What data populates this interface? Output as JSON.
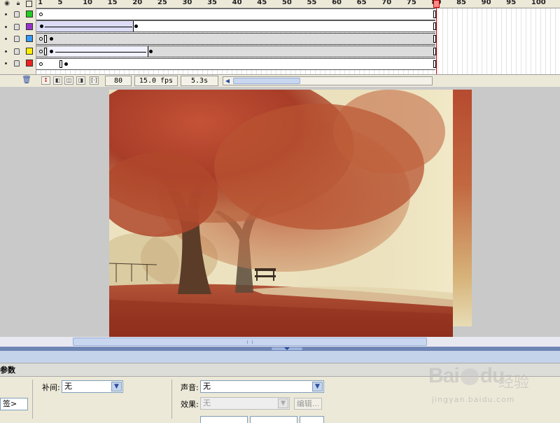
{
  "timeline": {
    "header_icons": [
      "eye-icon",
      "lock-icon",
      "outline-icon"
    ],
    "ruler_ticks": [
      "1",
      "5",
      "10",
      "15",
      "20",
      "25",
      "30",
      "35",
      "40",
      "45",
      "50",
      "55",
      "60",
      "65",
      "70",
      "75",
      "80",
      "85",
      "90",
      "95",
      "100"
    ],
    "layers": [
      {
        "color": "#22cc22"
      },
      {
        "color": "#9933cc"
      },
      {
        "color": "#3399ff"
      },
      {
        "color": "#ffee00"
      },
      {
        "color": "#ee2222"
      }
    ],
    "status": {
      "current_frame": "80",
      "fps": "15.0 fps",
      "time": "5.3s"
    }
  },
  "panel": {
    "title": "参数",
    "left_field": "签>",
    "tween_label": "补间:",
    "tween_value": "无",
    "sound_label": "声音:",
    "sound_value": "无",
    "effect_label": "效果:",
    "effect_value": "无",
    "edit_button": "编辑..."
  },
  "watermark": {
    "brand": "Bai",
    "brand2": "du",
    "brand_cn": "经验",
    "url": "jingyan.baidu.com"
  },
  "colors": {
    "playhead": "#cc0000",
    "stage_bg": "#c9c9c9",
    "splitter": "#6e86b4"
  }
}
